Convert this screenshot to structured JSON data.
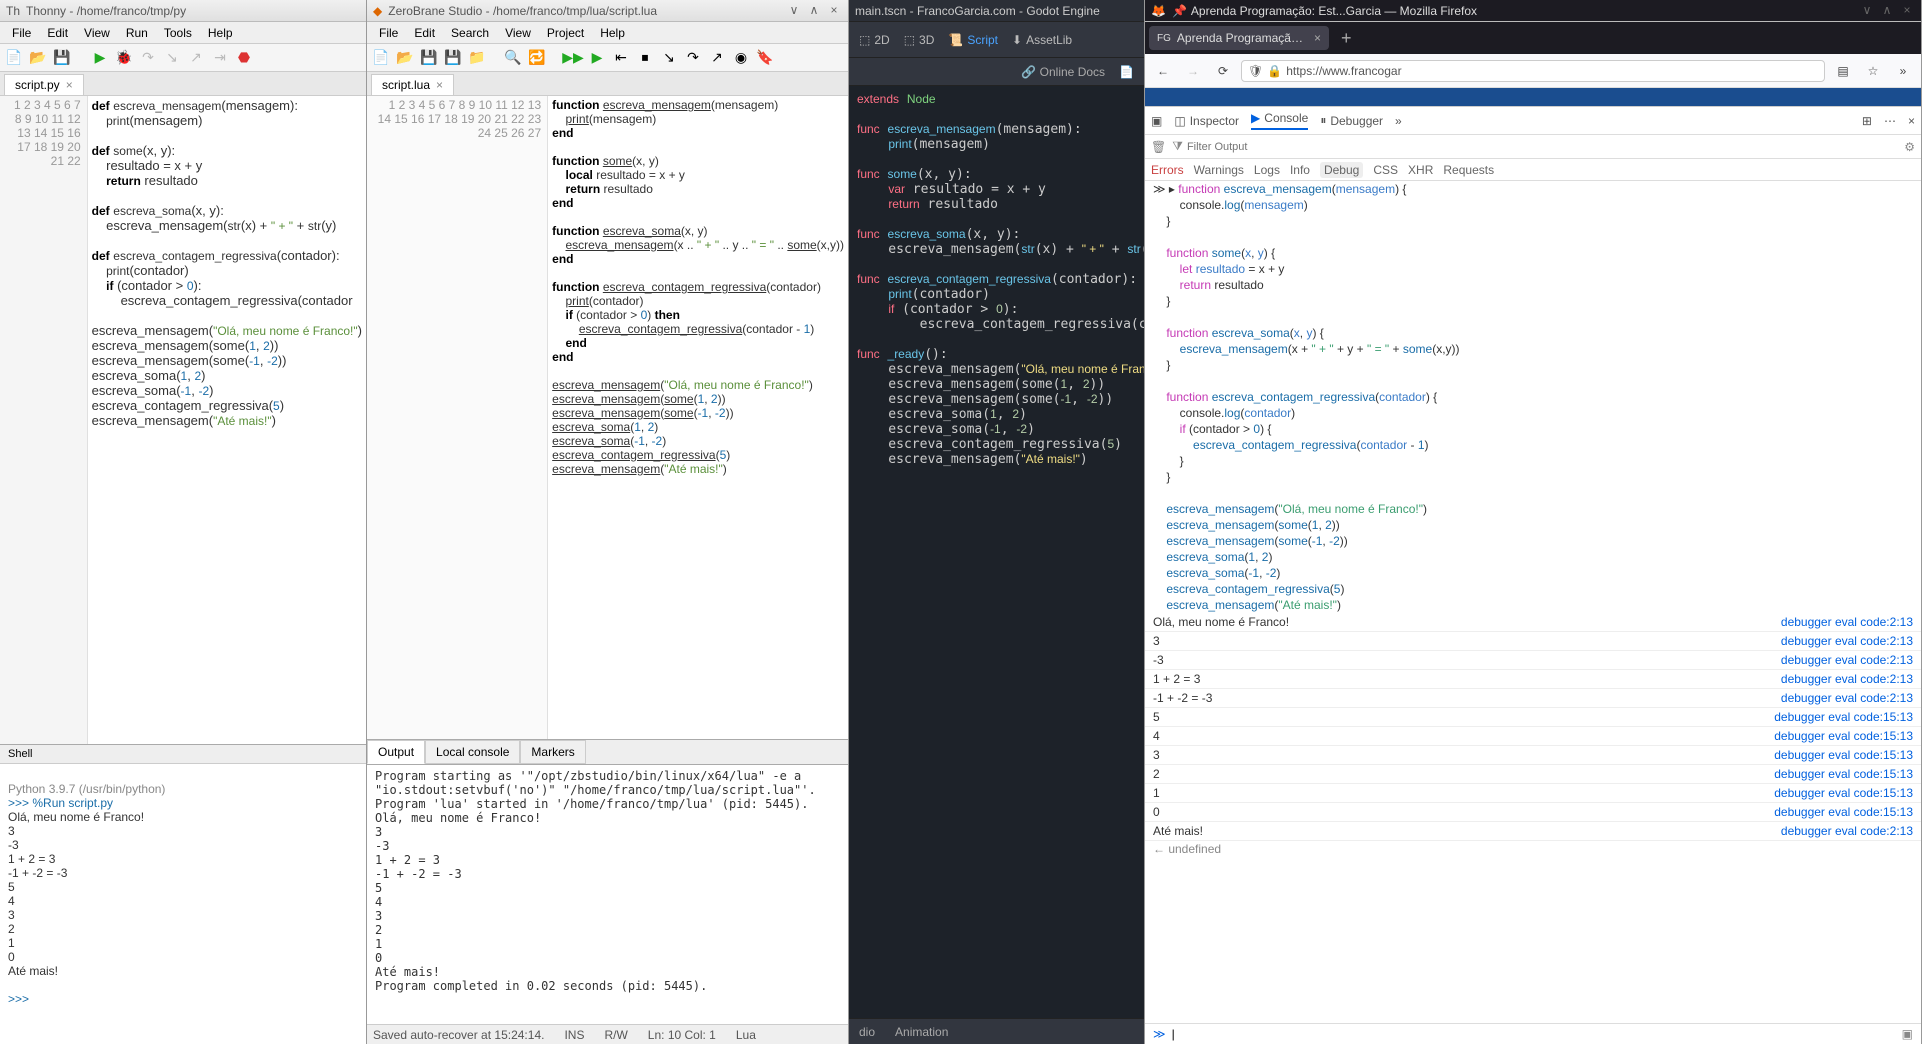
{
  "thonny": {
    "title": "Thonny - /home/franco/tmp/py",
    "menu": [
      "File",
      "Edit",
      "View",
      "Run",
      "Tools",
      "Help"
    ],
    "tab": "script.py",
    "lines": [
      "1",
      "2",
      "3",
      "4",
      "5",
      "6",
      "7",
      "8",
      "9",
      "10",
      "11",
      "12",
      "13",
      "14",
      "15",
      "16",
      "17",
      "18",
      "19",
      "20",
      "21",
      "22"
    ],
    "shell_title": "Shell",
    "shell_header": "Python 3.9.7 (/usr/bin/python)",
    "shell_run": ">>> %Run script.py",
    "shell_out": "\nOlá, meu nome é Franco!\n3\n-3\n1 + 2 = 3\n-1 + -2 = -3\n5\n4\n3\n2\n1\n0\nAté mais!\n",
    "shell_prompt": ">>> "
  },
  "zbs": {
    "title": "ZeroBrane Studio - /home/franco/tmp/lua/script.lua",
    "menu": [
      "File",
      "Edit",
      "Search",
      "View",
      "Project",
      "Help"
    ],
    "tab": "script.lua",
    "lines": [
      "1",
      "2",
      "3",
      "4",
      "5",
      "6",
      "7",
      "8",
      "9",
      "10",
      "11",
      "12",
      "13",
      "14",
      "15",
      "16",
      "17",
      "18",
      "19",
      "20",
      "21",
      "22",
      "23",
      "24",
      "25",
      "26",
      "27"
    ],
    "out_tabs": [
      "Output",
      "Local console",
      "Markers"
    ],
    "output": "Program starting as '\"/opt/zbstudio/bin/linux/x64/lua\" -e a\n\"io.stdout:setvbuf('no')\" \"/home/franco/tmp/lua/script.lua\"'.\nProgram 'lua' started in '/home/franco/tmp/lua' (pid: 5445).\nOlá, meu nome é Franco!\n3\n-3\n1 + 2 = 3\n-1 + -2 = -3\n5\n4\n3\n2\n1\n0\nAté mais!\nProgram completed in 0.02 seconds (pid: 5445).",
    "status": {
      "save": "Saved auto-recover at 15:24:14.",
      "ins": "INS",
      "rw": "R/W",
      "pos": "Ln: 10 Col: 1",
      "lang": "Lua"
    }
  },
  "godot": {
    "title": "main.tscn - FrancoGarcia.com - Godot Engine",
    "top": [
      "2D",
      "3D",
      "Script",
      "AssetLib"
    ],
    "docs": "Online Docs",
    "bottom": [
      "dio",
      "Animation"
    ]
  },
  "ff": {
    "title": "Aprenda Programação: Est...Garcia — Mozilla Firefox",
    "tab": "Aprenda Programação: Estru",
    "url": "https://www.francogar",
    "dt_tabs": [
      "Inspector",
      "Console",
      "Debugger"
    ],
    "filter_ph": "Filter Output",
    "cats": [
      "Errors",
      "Warnings",
      "Logs",
      "Info",
      "Debug",
      "CSS",
      "XHR",
      "Requests"
    ],
    "logs": [
      {
        "v": "Olá, meu nome é Franco!",
        "s": "debugger eval code:2:13"
      },
      {
        "v": "3",
        "s": "debugger eval code:2:13"
      },
      {
        "v": "-3",
        "s": "debugger eval code:2:13"
      },
      {
        "v": "1 + 2 = 3",
        "s": "debugger eval code:2:13"
      },
      {
        "v": "-1 + -2 = -3",
        "s": "debugger eval code:2:13"
      },
      {
        "v": "5",
        "s": "debugger eval code:15:13"
      },
      {
        "v": "4",
        "s": "debugger eval code:15:13"
      },
      {
        "v": "3",
        "s": "debugger eval code:15:13"
      },
      {
        "v": "2",
        "s": "debugger eval code:15:13"
      },
      {
        "v": "1",
        "s": "debugger eval code:15:13"
      },
      {
        "v": "0",
        "s": "debugger eval code:15:13"
      },
      {
        "v": "Até mais!",
        "s": "debugger eval code:2:13"
      }
    ],
    "undef": "← undefined"
  }
}
